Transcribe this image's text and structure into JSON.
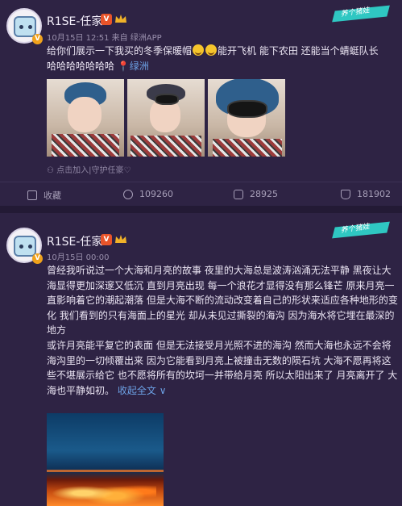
{
  "post1": {
    "author": "R1SE-任家",
    "meta": "10月15日 12:51 来自 绿洲APP",
    "text_line1": "给你们展示一下我买的冬季保暖帽",
    "text_line1b": "能开飞机 能下农田 还能当个蜻蜓队长",
    "text_line2": "哈哈哈哈哈哈哈",
    "link": "绿洲",
    "add_group": "点击加入|守护任豪♡",
    "actions": {
      "share": "收藏",
      "repost": "109260",
      "comment": "28925",
      "like": "181902"
    }
  },
  "post2": {
    "author": "R1SE-任家",
    "meta": "10月15日 00:00",
    "paragraph1": "曾经我听说过一个大海和月亮的故事 夜里的大海总是波涛汹涌无法平静 黑夜让大海显得更加深邃又低沉 直到月亮出现 每一个浪花才显得没有那么锋芒 原来月亮一直影响着它的潮起潮落 但是大海不断的流动改变着自己的形状来适应各种地形的变化 我们看到的只有海面上的星光 却从未见过撕裂的海沟 因为海水将它埋在最深的地方",
    "paragraph2": "或许月亮能平复它的表面 但是无法接受月光照不进的海沟 然而大海也永远不会将海沟里的一切倾覆出来 因为它能看到月亮上被撞击无数的陨石坑 大海不愿再将这些不堪展示给它 也不愿将所有的坎坷一并带给月亮 所以太阳出来了 月亮离开了 大海也平静如初。",
    "expand": "收起全文",
    "expand_chevron": "∨"
  },
  "banner_text": "养个猪娃"
}
